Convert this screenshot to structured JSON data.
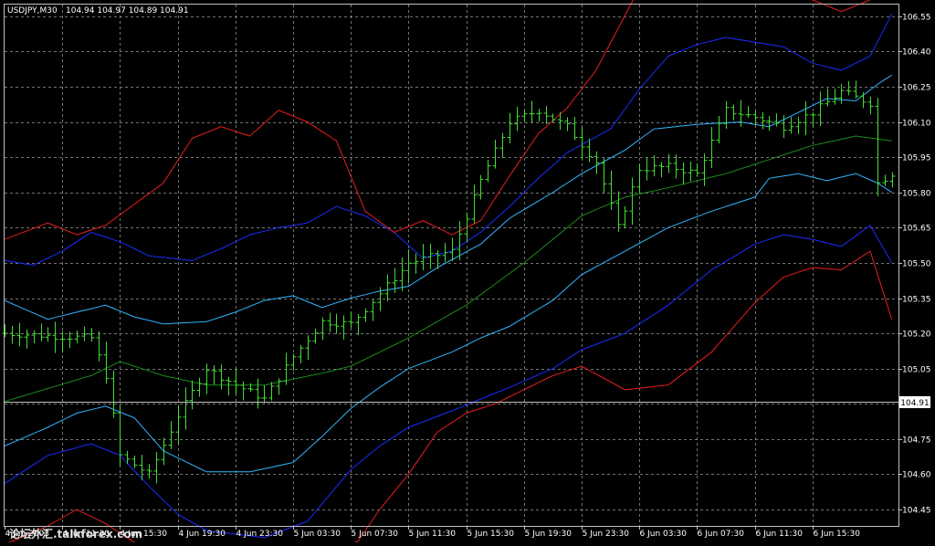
{
  "chart_data": {
    "type": "ohlc",
    "instrument": "USDJPY",
    "timeframe": "M30",
    "header": {
      "symbol_label": "USDJPY,M30",
      "ohlc_label": "104.94 104.97 104.89 104.91"
    },
    "current_price": {
      "label": "104.91",
      "value": 104.91
    },
    "ylim": [
      104.38,
      106.6
    ],
    "y_ticks": [
      "106.55",
      "106.40",
      "106.25",
      "106.10",
      "105.95",
      "105.80",
      "105.65",
      "105.50",
      "105.35",
      "105.20",
      "105.05",
      "104.90",
      "104.75",
      "104.60",
      "104.45"
    ],
    "x_ticks": [
      "4 Jun 2003",
      "4 Jun 11:30",
      "4 Jun 15:30",
      "4 Jun 19:30",
      "4 Jun 23:30",
      "5 Jun 03:30",
      "5 Jun 07:30",
      "5 Jun 11:30",
      "5 Jun 15:30",
      "5 Jun 19:30",
      "5 Jun 23:30",
      "6 Jun 03:30",
      "6 Jun 07:30",
      "6 Jun 11:30",
      "6 Jun 15:30"
    ],
    "bar_count": 124,
    "grid": true,
    "colors": {
      "background": "#000000",
      "grid": "#9a9a9a",
      "bars": "#44dd33",
      "ma": "#1c8a1c",
      "band_inner": "#33b5ff",
      "band_middle": "#1a2cff",
      "band_outer": "#e81e1e",
      "text": "#ffffff",
      "price_line": "#c0c0c0"
    },
    "series": [
      {
        "key": "ma",
        "points": [
          [
            0,
            104.91
          ],
          [
            12,
            105.02
          ],
          [
            16,
            105.08
          ],
          [
            22,
            105.02
          ],
          [
            28,
            104.98
          ],
          [
            36,
            104.98
          ],
          [
            44,
            105.03
          ],
          [
            48,
            105.06
          ],
          [
            56,
            105.18
          ],
          [
            64,
            105.32
          ],
          [
            72,
            105.5
          ],
          [
            80,
            105.7
          ],
          [
            86,
            105.78
          ],
          [
            92,
            105.82
          ],
          [
            100,
            105.88
          ],
          [
            108,
            105.96
          ],
          [
            112,
            106.0
          ],
          [
            118,
            106.04
          ],
          [
            123,
            106.02
          ]
        ]
      },
      {
        "key": "band_inner_upper",
        "points": [
          [
            0,
            105.34
          ],
          [
            6,
            105.26
          ],
          [
            10,
            105.29
          ],
          [
            14,
            105.32
          ],
          [
            18,
            105.27
          ],
          [
            22,
            105.24
          ],
          [
            28,
            105.25
          ],
          [
            32,
            105.29
          ],
          [
            36,
            105.34
          ],
          [
            40,
            105.36
          ],
          [
            44,
            105.31
          ],
          [
            48,
            105.35
          ],
          [
            52,
            105.38
          ],
          [
            56,
            105.4
          ],
          [
            60,
            105.48
          ],
          [
            66,
            105.58
          ],
          [
            70,
            105.69
          ],
          [
            76,
            105.8
          ],
          [
            80,
            105.88
          ],
          [
            86,
            105.98
          ],
          [
            90,
            106.07
          ],
          [
            96,
            106.09
          ],
          [
            102,
            106.1
          ],
          [
            106,
            106.08
          ],
          [
            110,
            106.14
          ],
          [
            114,
            106.2
          ],
          [
            118,
            106.19
          ],
          [
            121,
            106.26
          ],
          [
            123,
            106.3
          ]
        ]
      },
      {
        "key": "band_inner_lower",
        "points": [
          [
            0,
            104.72
          ],
          [
            6,
            104.8
          ],
          [
            10,
            104.86
          ],
          [
            14,
            104.89
          ],
          [
            18,
            104.84
          ],
          [
            22,
            104.7
          ],
          [
            28,
            104.61
          ],
          [
            34,
            104.61
          ],
          [
            40,
            104.65
          ],
          [
            44,
            104.76
          ],
          [
            48,
            104.88
          ],
          [
            52,
            104.97
          ],
          [
            56,
            105.05
          ],
          [
            62,
            105.12
          ],
          [
            66,
            105.18
          ],
          [
            70,
            105.23
          ],
          [
            76,
            105.34
          ],
          [
            80,
            105.45
          ],
          [
            86,
            105.55
          ],
          [
            92,
            105.65
          ],
          [
            98,
            105.72
          ],
          [
            104,
            105.78
          ],
          [
            106,
            105.86
          ],
          [
            110,
            105.88
          ],
          [
            114,
            105.85
          ],
          [
            118,
            105.88
          ],
          [
            121,
            105.84
          ],
          [
            123,
            105.8
          ]
        ]
      },
      {
        "key": "band_middle_upper",
        "points": [
          [
            0,
            105.51
          ],
          [
            4,
            105.49
          ],
          [
            8,
            105.55
          ],
          [
            12,
            105.63
          ],
          [
            16,
            105.59
          ],
          [
            20,
            105.53
          ],
          [
            26,
            105.51
          ],
          [
            30,
            105.56
          ],
          [
            34,
            105.62
          ],
          [
            38,
            105.65
          ],
          [
            42,
            105.67
          ],
          [
            46,
            105.74
          ],
          [
            50,
            105.7
          ],
          [
            54,
            105.63
          ],
          [
            58,
            105.52
          ],
          [
            62,
            105.55
          ],
          [
            66,
            105.63
          ],
          [
            70,
            105.74
          ],
          [
            74,
            105.86
          ],
          [
            78,
            105.97
          ],
          [
            84,
            106.07
          ],
          [
            88,
            106.24
          ],
          [
            92,
            106.38
          ],
          [
            96,
            106.43
          ],
          [
            100,
            106.46
          ],
          [
            104,
            106.44
          ],
          [
            108,
            106.42
          ],
          [
            112,
            106.35
          ],
          [
            116,
            106.32
          ],
          [
            120,
            106.38
          ],
          [
            123,
            106.56
          ]
        ]
      },
      {
        "key": "band_middle_lower",
        "points": [
          [
            0,
            104.56
          ],
          [
            6,
            104.68
          ],
          [
            12,
            104.73
          ],
          [
            16,
            104.68
          ],
          [
            20,
            104.55
          ],
          [
            24,
            104.43
          ],
          [
            28,
            104.36
          ],
          [
            36,
            104.33
          ],
          [
            42,
            104.4
          ],
          [
            48,
            104.62
          ],
          [
            52,
            104.72
          ],
          [
            56,
            104.8
          ],
          [
            62,
            104.87
          ],
          [
            66,
            104.92
          ],
          [
            70,
            104.97
          ],
          [
            76,
            105.05
          ],
          [
            80,
            105.13
          ],
          [
            86,
            105.2
          ],
          [
            92,
            105.32
          ],
          [
            98,
            105.47
          ],
          [
            104,
            105.58
          ],
          [
            108,
            105.62
          ],
          [
            112,
            105.6
          ],
          [
            116,
            105.57
          ],
          [
            120,
            105.66
          ],
          [
            123,
            105.5
          ]
        ]
      },
      {
        "key": "band_outer_upper",
        "points": [
          [
            0,
            105.6
          ],
          [
            6,
            105.67
          ],
          [
            10,
            105.62
          ],
          [
            14,
            105.66
          ],
          [
            18,
            105.75
          ],
          [
            22,
            105.84
          ],
          [
            26,
            106.03
          ],
          [
            30,
            106.08
          ],
          [
            34,
            106.04
          ],
          [
            38,
            106.15
          ],
          [
            42,
            106.1
          ],
          [
            46,
            106.02
          ],
          [
            50,
            105.72
          ],
          [
            54,
            105.63
          ],
          [
            58,
            105.68
          ],
          [
            62,
            105.62
          ],
          [
            66,
            105.68
          ],
          [
            70,
            105.87
          ],
          [
            74,
            106.05
          ],
          [
            78,
            106.16
          ],
          [
            82,
            106.32
          ],
          [
            88,
            106.67
          ],
          [
            92,
            106.82
          ],
          [
            100,
            106.87
          ],
          [
            108,
            106.67
          ],
          [
            116,
            106.57
          ],
          [
            120,
            106.62
          ],
          [
            123,
            106.74
          ]
        ]
      },
      {
        "key": "band_outer_lower",
        "points": [
          [
            0,
            104.3
          ],
          [
            6,
            104.38
          ],
          [
            10,
            104.45
          ],
          [
            14,
            104.39
          ],
          [
            18,
            104.31
          ],
          [
            22,
            104.23
          ],
          [
            30,
            104.11
          ],
          [
            36,
            104.04
          ],
          [
            42,
            104.1
          ],
          [
            48,
            104.27
          ],
          [
            52,
            104.45
          ],
          [
            56,
            104.6
          ],
          [
            60,
            104.78
          ],
          [
            64,
            104.86
          ],
          [
            68,
            104.9
          ],
          [
            72,
            104.96
          ],
          [
            76,
            105.02
          ],
          [
            80,
            105.06
          ],
          [
            86,
            104.96
          ],
          [
            92,
            104.98
          ],
          [
            98,
            105.12
          ],
          [
            104,
            105.33
          ],
          [
            108,
            105.44
          ],
          [
            112,
            105.48
          ],
          [
            116,
            105.47
          ],
          [
            120,
            105.55
          ],
          [
            123,
            105.26
          ]
        ]
      }
    ],
    "price_path": [
      [
        0,
        105.2
      ],
      [
        12,
        105.18
      ],
      [
        14,
        105.02
      ],
      [
        16,
        104.68
      ],
      [
        20,
        104.6
      ],
      [
        24,
        104.85
      ],
      [
        28,
        105.05
      ],
      [
        32,
        104.98
      ],
      [
        36,
        104.92
      ],
      [
        40,
        105.1
      ],
      [
        44,
        105.25
      ],
      [
        48,
        105.24
      ],
      [
        52,
        105.37
      ],
      [
        56,
        105.5
      ],
      [
        62,
        105.55
      ],
      [
        66,
        105.85
      ],
      [
        70,
        106.1
      ],
      [
        74,
        106.15
      ],
      [
        78,
        106.08
      ],
      [
        82,
        105.93
      ],
      [
        85,
        105.65
      ],
      [
        88,
        105.9
      ],
      [
        92,
        105.91
      ],
      [
        96,
        105.88
      ],
      [
        100,
        106.15
      ],
      [
        104,
        106.12
      ],
      [
        108,
        106.08
      ],
      [
        112,
        106.14
      ],
      [
        116,
        106.23
      ],
      [
        120,
        106.18
      ],
      [
        121,
        105.84
      ],
      [
        123,
        105.88
      ]
    ]
  },
  "watermark": {
    "text": "论坛外汇.talkforex.com"
  }
}
